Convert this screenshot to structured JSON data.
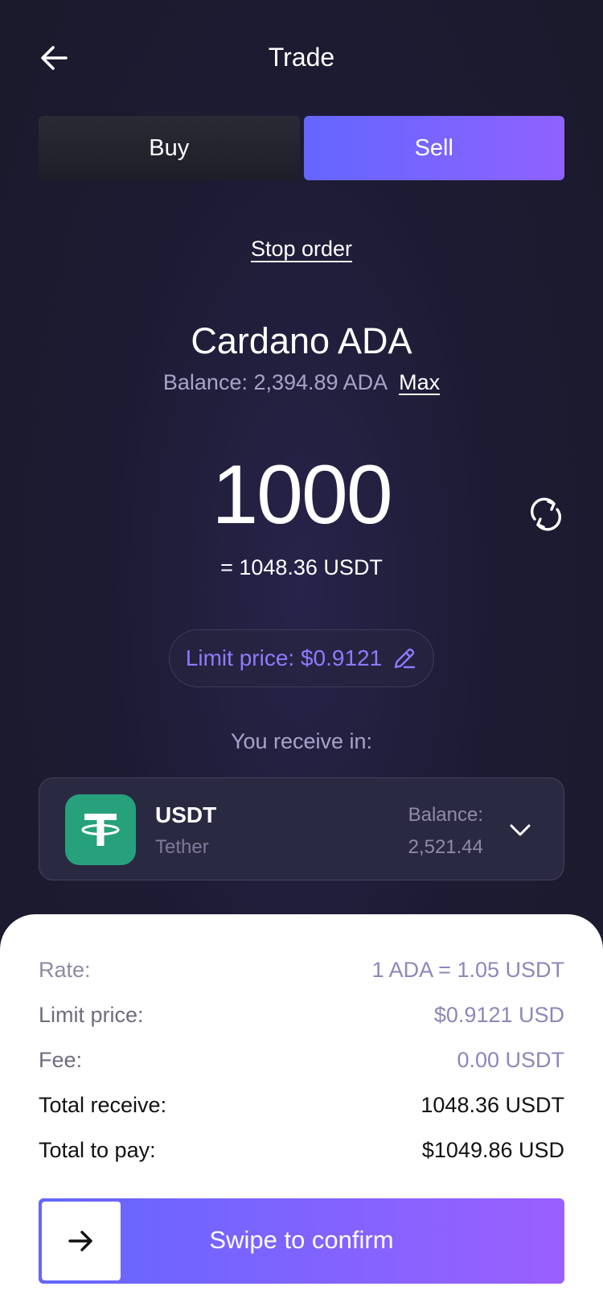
{
  "header": {
    "title": "Trade",
    "back_icon": "arrow-left-icon"
  },
  "tabs": [
    {
      "label": "Buy",
      "active": false
    },
    {
      "label": "Sell",
      "active": true
    }
  ],
  "order_type_link": "Stop order",
  "asset": {
    "name": "Cardano ADA",
    "balance": "Balance: 2,394.89 ADA",
    "max_label": "Max"
  },
  "amount": {
    "value": "1000",
    "equivalent": "= 1048.36 USDT",
    "swap_icon": "refresh-cycle-icon"
  },
  "limit_price_pill": {
    "label": "Limit price: $0.9121",
    "icon": "pencil-icon"
  },
  "receive": {
    "label": "You receive in:",
    "currency": {
      "code": "USDT",
      "name": "Tether",
      "balance_label": "Balance:",
      "balance_value": "2,521.44",
      "logo_color": "#26a17b"
    }
  },
  "summary": {
    "rate": {
      "label": "Rate:",
      "value": "1 ADA = 1.05 USDT"
    },
    "limit_price": {
      "label": "Limit price:",
      "value": "$0.9121 USD"
    },
    "fee": {
      "label": "Fee:",
      "value": "0.00 USDT"
    },
    "total_receive": {
      "label": "Total receive:",
      "value": "1048.36 USDT"
    },
    "total_pay": {
      "label": "Total to pay:",
      "value": "$1049.86 USD"
    }
  },
  "confirm": {
    "label": "Swipe to confirm",
    "handle_icon": "arrow-right-icon"
  },
  "colors": {
    "accent_start": "#6466ff",
    "accent_end": "#9a60ff",
    "background": "#1d1b33",
    "link_purple": "#8b7bff"
  }
}
